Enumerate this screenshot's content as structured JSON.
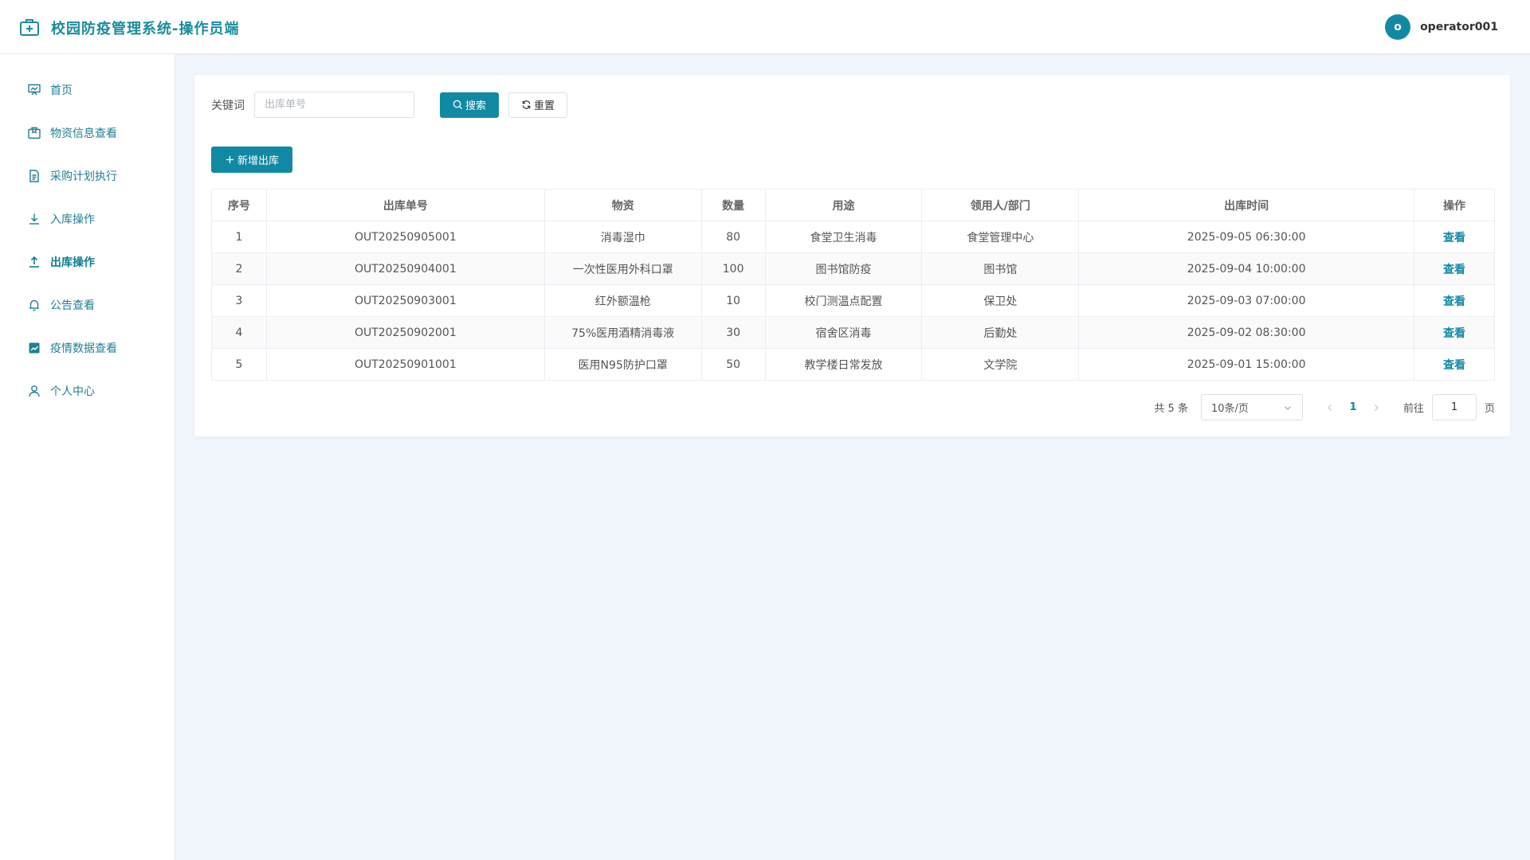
{
  "app": {
    "title": "校园防疫管理系统-操作员端"
  },
  "user": {
    "avatar_letter": "o",
    "name": "operator001"
  },
  "sidebar": {
    "items": [
      {
        "label": "首页",
        "icon": "dashboard-icon"
      },
      {
        "label": "物资信息查看",
        "icon": "package-icon"
      },
      {
        "label": "采购计划执行",
        "icon": "document-icon"
      },
      {
        "label": "入库操作",
        "icon": "download-icon"
      },
      {
        "label": "出库操作",
        "icon": "upload-icon",
        "active": true
      },
      {
        "label": "公告查看",
        "icon": "bell-icon"
      },
      {
        "label": "疫情数据查看",
        "icon": "chart-icon"
      },
      {
        "label": "个人中心",
        "icon": "user-icon"
      }
    ]
  },
  "search": {
    "label": "关键词",
    "placeholder": "出库单号",
    "value": "",
    "search_button": "搜索",
    "reset_button": "重置"
  },
  "actions": {
    "add_button": "新增出库"
  },
  "table": {
    "headers": [
      "序号",
      "出库单号",
      "物资",
      "数量",
      "用途",
      "领用人/部门",
      "出库时间",
      "操作"
    ],
    "rows": [
      {
        "index": "1",
        "order_no": "OUT20250905001",
        "material": "消毒湿巾",
        "quantity": "80",
        "purpose": "食堂卫生消毒",
        "receiver": "食堂管理中心",
        "time": "2025-09-05 06:30:00",
        "action": "查看"
      },
      {
        "index": "2",
        "order_no": "OUT20250904001",
        "material": "一次性医用外科口罩",
        "quantity": "100",
        "purpose": "图书馆防疫",
        "receiver": "图书馆",
        "time": "2025-09-04 10:00:00",
        "action": "查看"
      },
      {
        "index": "3",
        "order_no": "OUT20250903001",
        "material": "红外额温枪",
        "quantity": "10",
        "purpose": "校门测温点配置",
        "receiver": "保卫处",
        "time": "2025-09-03 07:00:00",
        "action": "查看"
      },
      {
        "index": "4",
        "order_no": "OUT20250902001",
        "material": "75%医用酒精消毒液",
        "quantity": "30",
        "purpose": "宿舍区消毒",
        "receiver": "后勤处",
        "time": "2025-09-02 08:30:00",
        "action": "查看"
      },
      {
        "index": "5",
        "order_no": "OUT20250901001",
        "material": "医用N95防护口罩",
        "quantity": "50",
        "purpose": "教学楼日常发放",
        "receiver": "文学院",
        "time": "2025-09-01 15:00:00",
        "action": "查看"
      }
    ]
  },
  "pagination": {
    "total_text": "共 5 条",
    "page_size": "10条/页",
    "current_page": "1",
    "goto_label": "前往",
    "goto_value": "1",
    "page_unit": "页"
  },
  "colors": {
    "accent": "#1289a3",
    "title": "#1b8c9c",
    "background": "#f0f6fb"
  }
}
